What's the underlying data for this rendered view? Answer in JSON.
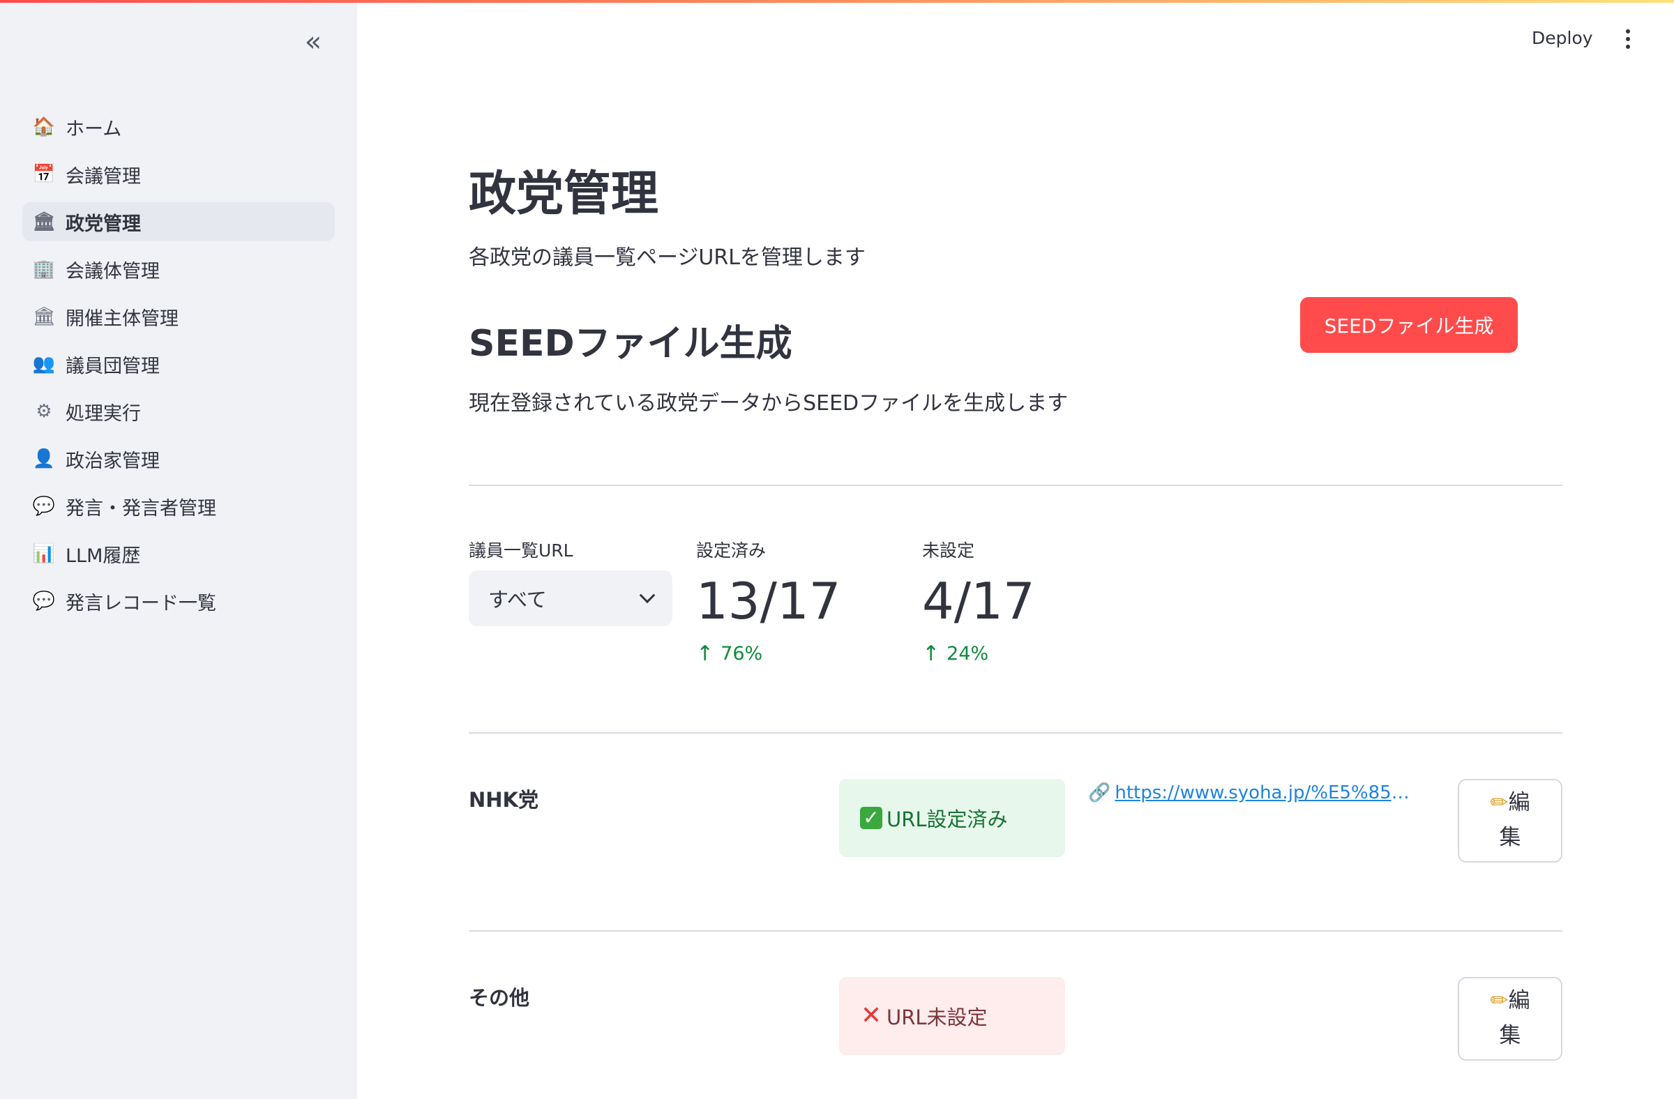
{
  "sidebar": {
    "collapse_icon": "«",
    "items": [
      {
        "icon": "house-icon",
        "glyph": "🏠",
        "label": "ホーム",
        "active": false
      },
      {
        "icon": "calendar-icon",
        "glyph": "📅",
        "label": "会議管理",
        "active": false
      },
      {
        "icon": "classical-building-icon",
        "glyph": "🏛",
        "label": "政党管理",
        "active": true
      },
      {
        "icon": "office-building-icon",
        "glyph": "🏢",
        "label": "会議体管理",
        "active": false
      },
      {
        "icon": "classical-building-icon",
        "glyph": "🏛",
        "label": "開催主体管理",
        "active": false
      },
      {
        "icon": "people-icon",
        "glyph": "👥",
        "label": "議員団管理",
        "active": false
      },
      {
        "icon": "gear-icon",
        "glyph": "⚙",
        "label": "処理実行",
        "active": false
      },
      {
        "icon": "person-icon",
        "glyph": "👤",
        "label": "政治家管理",
        "active": false
      },
      {
        "icon": "speech-bubble-icon",
        "glyph": "💬",
        "label": "発言・発言者管理",
        "active": false
      },
      {
        "icon": "bar-chart-icon",
        "glyph": "📊",
        "label": "LLM履歴",
        "active": false
      },
      {
        "icon": "speech-bubble-icon",
        "glyph": "💬",
        "label": "発言レコード一覧",
        "active": false
      }
    ]
  },
  "header": {
    "deploy_label": "Deploy"
  },
  "main": {
    "title": "政党管理",
    "description": "各政党の議員一覧ページURLを管理します",
    "seed": {
      "title": "SEEDファイル生成",
      "button_label": "SEEDファイル生成",
      "description": "現在登録されている政党データからSEEDファイルを生成します"
    },
    "filter": {
      "label": "議員一覧URL",
      "selected": "すべて"
    },
    "metrics": [
      {
        "label": "設定済み",
        "value": "13/17",
        "delta": "76%"
      },
      {
        "label": "未設定",
        "value": "4/17",
        "delta": "24%"
      }
    ],
    "parties": [
      {
        "name": "NHK党",
        "status": "URL設定済み",
        "status_type": "ok",
        "url": "https://www.syoha.jp/%E5%85%9A...",
        "edit_line1": "編",
        "edit_line2": "集"
      },
      {
        "name": "その他",
        "status": "URL未設定",
        "status_type": "ng",
        "url": "",
        "edit_line1": "編",
        "edit_line2": "集"
      }
    ]
  },
  "colors": {
    "primary": "#ff4b4b",
    "sidebar_bg": "#f0f2f6",
    "success_bg": "#e7f7ec",
    "error_bg": "#ffecec",
    "link": "#1c83e1",
    "delta_up": "#0e8a3a"
  }
}
